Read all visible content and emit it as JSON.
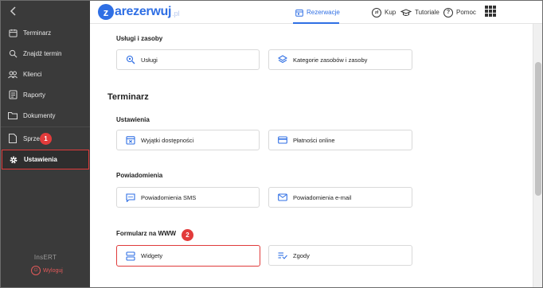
{
  "sidebar": {
    "back_icon": "chevron-left-icon",
    "items": [
      {
        "label": "Terminarz",
        "icon": "calendar-icon"
      },
      {
        "label": "Znajdź termin",
        "icon": "search-icon"
      },
      {
        "label": "Klienci",
        "icon": "users-icon"
      },
      {
        "label": "Raporty",
        "icon": "report-icon"
      },
      {
        "label": "Dokumenty",
        "icon": "folder-icon"
      },
      {
        "label": "Sprzedaż",
        "icon": "document-icon"
      },
      {
        "label": "Ustawienia",
        "icon": "gear-icon"
      }
    ],
    "active_item": "Ustawienia",
    "footer_title": "InsERT",
    "logout_label": "Wyloguj"
  },
  "annotations": {
    "badge_1": "1",
    "badge_2": "2"
  },
  "topbar": {
    "logo_letter": "z",
    "logo_text": "arezerwuj",
    "logo_suffix": ".pl",
    "reservations_label": "Rezerwacje",
    "buy_label": "Kup",
    "buy_icon_text": "zł",
    "tutorials_label": "Tutoriale",
    "help_label": "Pomoc",
    "help_icon_text": "?"
  },
  "content": {
    "services_section": {
      "title": "Usługi i zasoby",
      "cards": [
        {
          "label": "Usługi",
          "icon": "services-icon"
        },
        {
          "label": "Kategorie zasobów i zasoby",
          "icon": "layers-icon"
        }
      ]
    },
    "calendar_heading": "Terminarz",
    "settings_section": {
      "title": "Ustawienia",
      "cards": [
        {
          "label": "Wyjątki dostępności",
          "icon": "calendar-exception-icon"
        },
        {
          "label": "Płatności online",
          "icon": "credit-card-icon"
        }
      ]
    },
    "notifications_section": {
      "title": "Powiadomienia",
      "cards": [
        {
          "label": "Powiadomienia SMS",
          "icon": "sms-icon"
        },
        {
          "label": "Powiadomienia e-mail",
          "icon": "mail-icon"
        }
      ]
    },
    "www_section": {
      "title": "Formularz na WWW",
      "cards": [
        {
          "label": "Widgety",
          "icon": "widget-icon"
        },
        {
          "label": "Zgody",
          "icon": "consent-icon"
        }
      ]
    }
  },
  "colors": {
    "accent": "#2f6fe4",
    "highlight": "#e03b3b",
    "sidebar_bg": "#3a3a3a"
  }
}
